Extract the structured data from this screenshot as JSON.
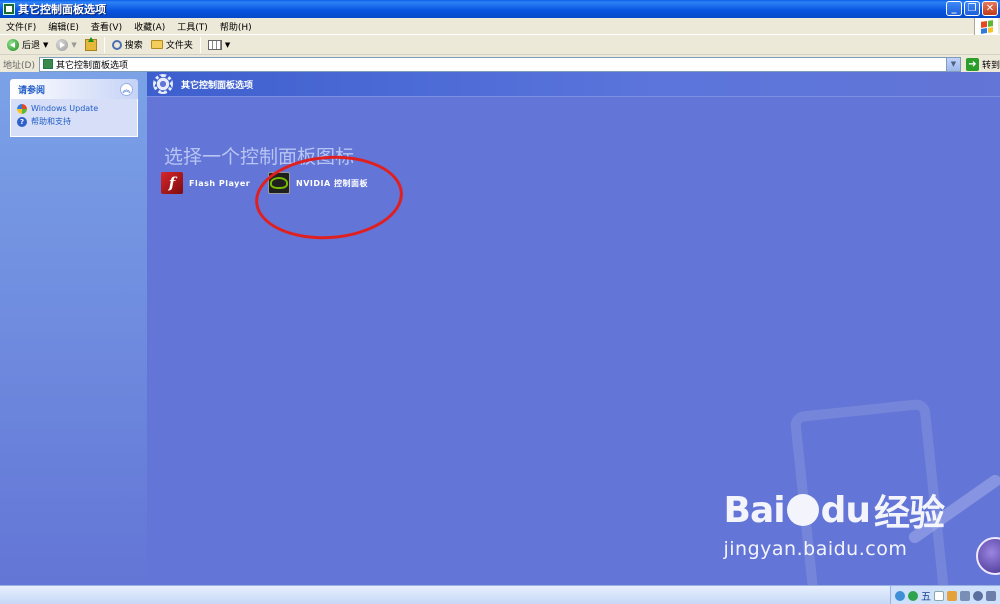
{
  "window": {
    "title": "其它控制面板选项",
    "buttons": {
      "minimize": "_",
      "maximize": "❐",
      "close": "✕"
    }
  },
  "menu": [
    "文件(F)",
    "编辑(E)",
    "查看(V)",
    "收藏(A)",
    "工具(T)",
    "帮助(H)"
  ],
  "toolbar": {
    "back_label": "后退",
    "search_label": "搜索",
    "folders_label": "文件夹"
  },
  "address": {
    "label": "地址(D)",
    "value": "其它控制面板选项",
    "go_label": "转到"
  },
  "sidebar": {
    "title": "请参阅",
    "links": [
      "Windows Update",
      "帮助和支持"
    ]
  },
  "main": {
    "header_title": "其它控制面板选项",
    "section_heading": "选择一个控制面板图标",
    "items": [
      {
        "label": "Flash Player",
        "icon": "flash-player-icon"
      },
      {
        "label": "NVIDIA 控制面板",
        "icon": "nvidia-icon"
      }
    ]
  },
  "watermark": {
    "brand_left": "Bai",
    "brand_mid": "du",
    "brand_cn": "经验",
    "url": "jingyan.baidu.com"
  },
  "tray": {
    "ime_label": "五"
  },
  "colors": {
    "main_bg": "#6375D6",
    "sidebar_link": "#215DC6",
    "annotation": "#E02020",
    "titlebar": "#0653E0"
  }
}
